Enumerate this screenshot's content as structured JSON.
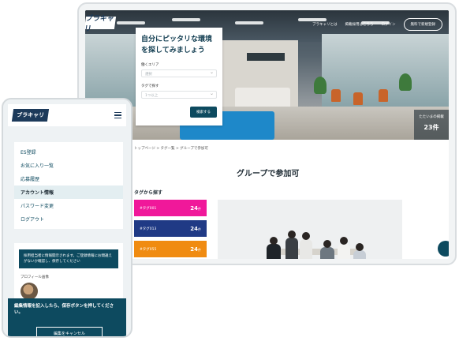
{
  "desktop": {
    "header": {
      "logo_text": "ブラキャリ",
      "nav": [
        "ブラキャリとは",
        "掲載採用はこちら",
        "ログイン"
      ],
      "cta_label": "無料で新規登録"
    },
    "search": {
      "title": "自分にピッタリな環境を探してみましょう",
      "area_label": "働くエリア",
      "area_placeholder": "選択",
      "tag_label": "タグで探す",
      "tag_placeholder": "1つ以上",
      "submit_label": "検索する"
    },
    "counter": {
      "text": "たたいまの掲載",
      "value": "23件"
    },
    "breadcrumb": "トップページ > タグ一覧 > グループで参加可",
    "page_title": "グループで参加可",
    "tags_heading": "タグから探す",
    "tags": [
      {
        "name": "#タグ001",
        "count": "24",
        "unit": "件",
        "color": "#f0189a"
      },
      {
        "name": "#タグ013",
        "count": "24",
        "unit": "件",
        "color": "#203a85"
      },
      {
        "name": "#タグ055",
        "count": "24",
        "unit": "件",
        "color": "#f08b11"
      }
    ]
  },
  "mobile": {
    "logo_text": "ブラキャリ",
    "menu": [
      "ES登録",
      "お気に入り一覧",
      "応募履歴",
      "アカウント情報",
      "パスワード変更",
      "ログアウト"
    ],
    "active_menu_index": 3,
    "notice": "採用担当者に情報開示されます。ご登録情報にお間違えがないか確認し、保存してください",
    "photo_label": "プロフィール画像",
    "footer_message": "編集情報を記入したら、保存ボタンを押してください。",
    "cancel_label": "編集をキャンセル"
  },
  "colors": {
    "brand": "#0d4a5f",
    "logo": "#1c3a5a",
    "accent_pink": "#f0189a",
    "accent_navy": "#203a85",
    "accent_orange": "#f08b11"
  }
}
